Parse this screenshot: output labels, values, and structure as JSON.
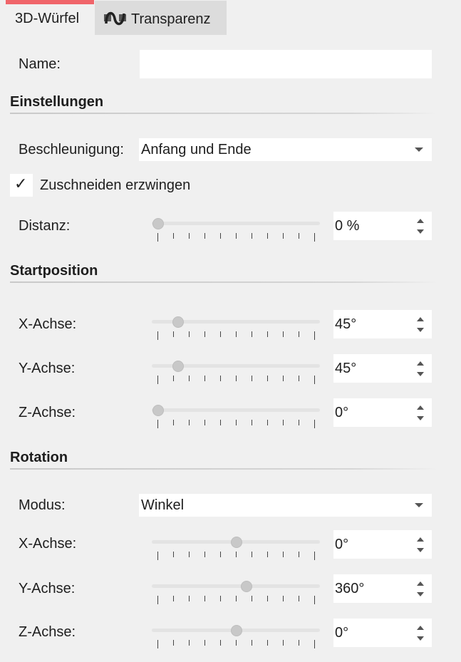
{
  "tabs": {
    "cube": "3D-Würfel",
    "transparency": "Transparenz"
  },
  "name": {
    "label": "Name:",
    "value": ""
  },
  "settings": {
    "heading": "Einstellungen",
    "acceleration": {
      "label": "Beschleunigung:",
      "value": "Anfang und Ende"
    },
    "crop": {
      "label": "Zuschneiden erzwingen",
      "checked": true,
      "mark": "✓"
    },
    "distance": {
      "label": "Distanz:",
      "value": "0 %",
      "level": 0
    }
  },
  "start_position": {
    "heading": "Startposition",
    "x": {
      "label": "X-Achse:",
      "value": "45°",
      "level": 0.125
    },
    "y": {
      "label": "Y-Achse:",
      "value": "45°",
      "level": 0.125
    },
    "z": {
      "label": "Z-Achse:",
      "value": "0°",
      "level": 0
    }
  },
  "rotation": {
    "heading": "Rotation",
    "mode": {
      "label": "Modus:",
      "value": "Winkel"
    },
    "x": {
      "label": "X-Achse:",
      "value": "0°",
      "level": 0.5
    },
    "y": {
      "label": "Y-Achse:",
      "value": "360°",
      "level": 0.5625
    },
    "z": {
      "label": "Z-Achse:",
      "value": "0°",
      "level": 0.5
    }
  },
  "colors": {
    "tab_accent": "#f0656a",
    "panel_bg": "#f0f0f0",
    "inactive_tab": "#dcdcdc"
  }
}
